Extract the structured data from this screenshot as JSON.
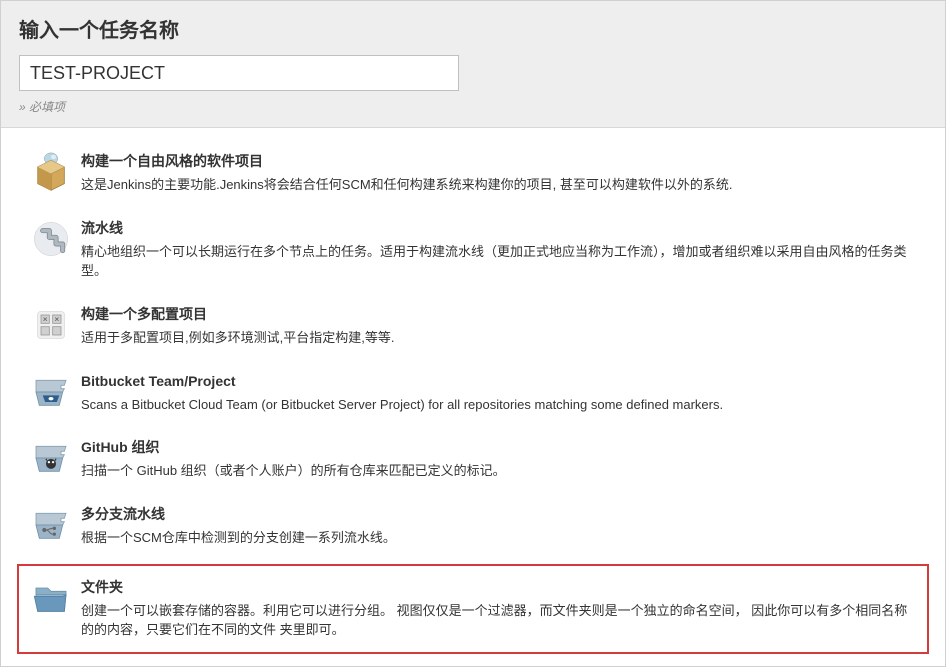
{
  "header": {
    "title": "输入一个任务名称",
    "input_value": "TEST-PROJECT",
    "required": "» 必填项"
  },
  "items": [
    {
      "title": "构建一个自由风格的软件项目",
      "desc": "这是Jenkins的主要功能.Jenkins将会结合任何SCM和任何构建系统来构建你的项目, 甚至可以构建软件以外的系统."
    },
    {
      "title": "流水线",
      "desc": "精心地组织一个可以长期运行在多个节点上的任务。适用于构建流水线（更加正式地应当称为工作流），增加或者组织难以采用自由风格的任务类型。"
    },
    {
      "title": "构建一个多配置项目",
      "desc": "适用于多配置项目,例如多环境测试,平台指定构建,等等."
    },
    {
      "title": "Bitbucket Team/Project",
      "desc": "Scans a Bitbucket Cloud Team (or Bitbucket Server Project) for all repositories matching some defined markers."
    },
    {
      "title": "GitHub 组织",
      "desc": "扫描一个 GitHub 组织（或者个人账户）的所有仓库来匹配已定义的标记。"
    },
    {
      "title": "多分支流水线",
      "desc": "根据一个SCM仓库中检测到的分支创建一系列流水线。"
    },
    {
      "title": "文件夹",
      "desc": "创建一个可以嵌套存储的容器。利用它可以进行分组。 视图仅仅是一个过滤器，而文件夹则是一个独立的命名空间， 因此你可以有多个相同名称的的内容，只要它们在不同的文件 夹里即可。"
    }
  ]
}
